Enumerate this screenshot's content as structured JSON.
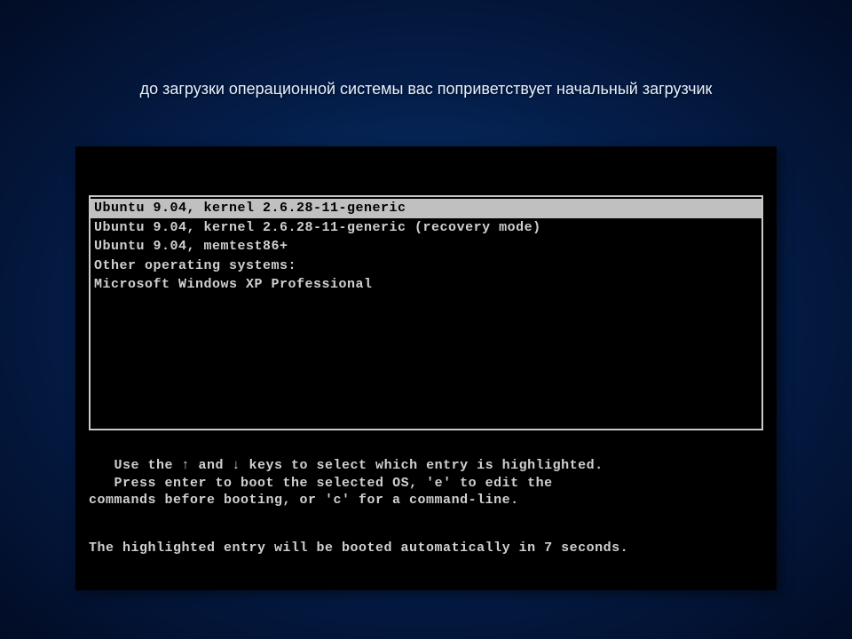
{
  "slide": {
    "title": "до загрузки операционной системы вас поприветствует начальный загрузчик"
  },
  "boot": {
    "entries": {
      "e0": "Ubuntu 9.04, kernel 2.6.28-11-generic",
      "e1": "Ubuntu 9.04, kernel 2.6.28-11-generic (recovery mode)",
      "e2": "Ubuntu 9.04, memtest86+",
      "e3": "Other operating systems:",
      "e4": "Microsoft Windows XP Professional"
    },
    "instructions_line1": "   Use the ↑ and ↓ keys to select which entry is highlighted.",
    "instructions_line2": "   Press enter to boot the selected OS, 'e' to edit the",
    "instructions_line3": "commands before booting, or 'c' for a command-line.",
    "countdown": "   The highlighted entry will be booted automatically in 7 seconds."
  }
}
